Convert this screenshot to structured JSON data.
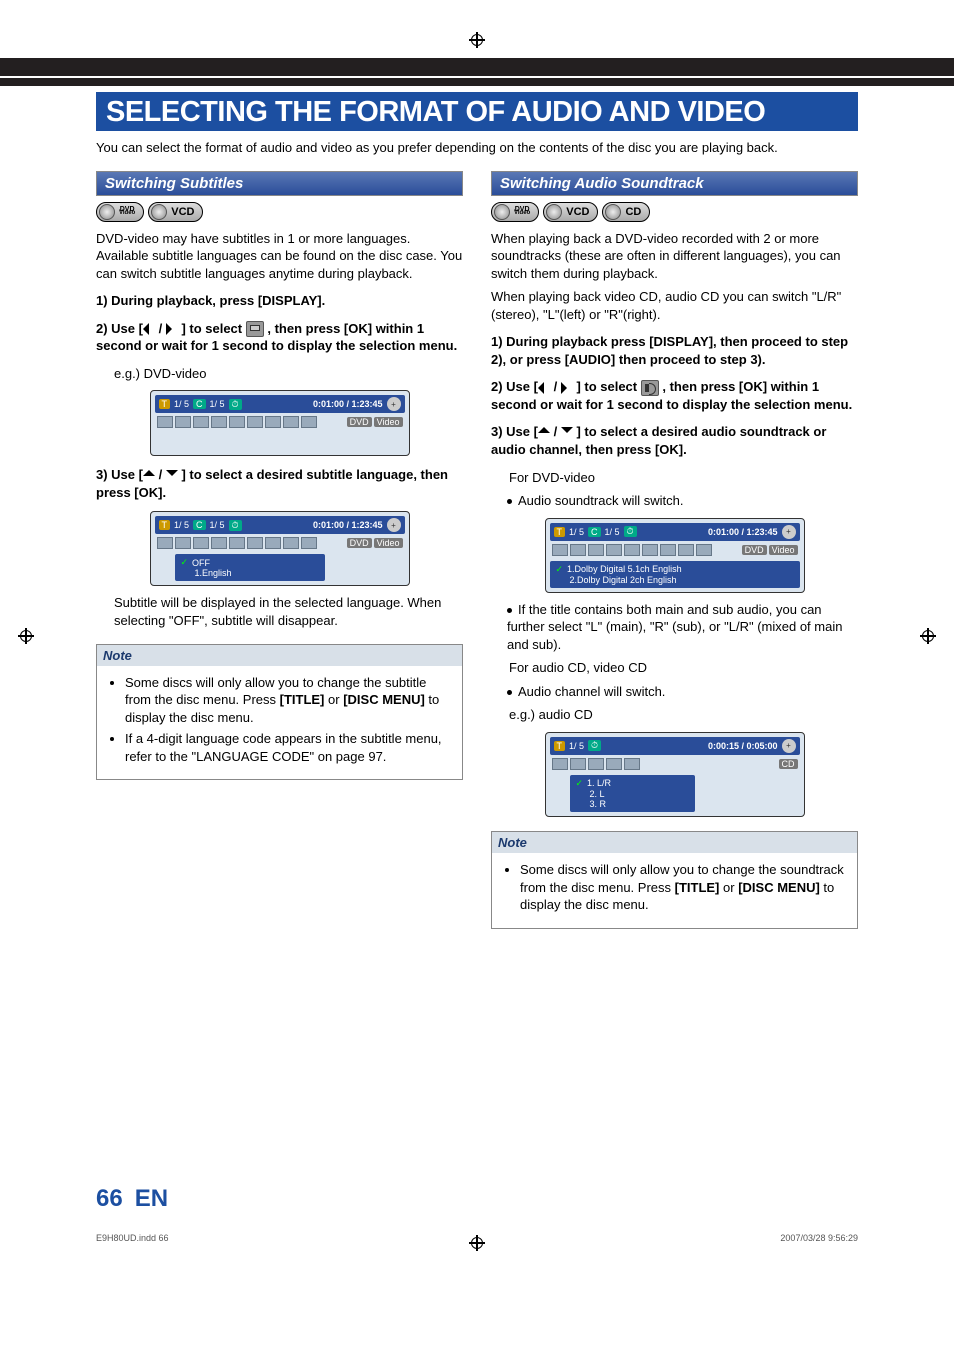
{
  "page_title": "SELECTING THE FORMAT OF AUDIO AND VIDEO",
  "intro": "You can select the format of audio and video as you prefer depending on the contents of the disc you are playing back.",
  "left": {
    "section_title": "Switching Subtitles",
    "discs": [
      "DVD Video",
      "VCD"
    ],
    "body1": "DVD-video may have subtitles in 1 or more languages. Available subtitle languages can be found on the disc case. You can switch subtitle languages anytime during playback.",
    "step1": "During playback, press [DISPLAY].",
    "step2_pre": "Use [",
    "step2_mid": "] to select ",
    "step2_post": " , then press [OK] within 1 second or wait for 1 second to display the selection menu.",
    "eg": "e.g.) DVD-video",
    "osd1": {
      "tc": [
        "1/  5",
        "1/  5"
      ],
      "time": "0:01:00 / 1:23:45",
      "badge1": "DVD",
      "badge2": "Video"
    },
    "step3_pre": "Use [",
    "step3_post": "] to select a desired subtitle language, then press [OK].",
    "osd2": {
      "tc": [
        "1/  5",
        "1/  5"
      ],
      "time": "0:01:00 / 1:23:45",
      "badge1": "DVD",
      "badge2": "Video",
      "menu": [
        "OFF",
        "1.English"
      ]
    },
    "after": "Subtitle will be displayed in the selected language. When selecting \"OFF\", subtitle will disappear.",
    "note_title": "Note",
    "note_items": [
      "Some discs will only allow you to change the subtitle from the disc menu. Press [TITLE] or [DISC MENU] to display the disc menu.",
      "If a 4-digit language code appears in the subtitle menu, refer to the \"LANGUAGE CODE\" on page 97."
    ]
  },
  "right": {
    "section_title": "Switching Audio Soundtrack",
    "discs": [
      "DVD Video",
      "VCD",
      "CD"
    ],
    "body1": "When playing back a DVD-video recorded with 2 or more soundtracks (these are often in different languages), you can switch them during playback.",
    "body2": "When playing back video CD, audio CD you can switch \"L/R\"(stereo), \"L\"(left) or \"R\"(right).",
    "step1": "During playback press [DISPLAY], then proceed to step 2), or press [AUDIO] then proceed to step 3).",
    "step2_pre": "Use [",
    "step2_mid": "] to select ",
    "step2_post": " , then press [OK] within 1 second or wait for 1 second to display the selection menu.",
    "step3_pre": "Use [",
    "step3_post": "] to select a desired audio soundtrack or audio channel, then press [OK].",
    "for_dvd": "For DVD-video",
    "bullet1": "Audio soundtrack will switch.",
    "osd1": {
      "tc": [
        "1/  5",
        "1/  5"
      ],
      "time": "0:01:00 / 1:23:45",
      "badge1": "DVD",
      "badge2": "Video",
      "menu": [
        "1.Dolby Digital  5.1ch English",
        "2.Dolby Digital    2ch English"
      ]
    },
    "bullet2": "If the title contains both main and sub audio, you can further select \"L\" (main), \"R\" (sub), or \"L/R\" (mixed of main and sub).",
    "for_cd": "For audio CD, video CD",
    "bullet3": "Audio channel will switch.",
    "eg": "e.g.) audio CD",
    "osd2": {
      "tc": [
        "1/  5"
      ],
      "time": "0:00:15 / 0:05:00",
      "badge1": "CD",
      "menu": [
        "1. L/R",
        "2. L",
        "3. R"
      ]
    },
    "note_title": "Note",
    "note_items": [
      "Some discs will only allow you to change the soundtrack from the disc menu. Press [TITLE] or [DISC MENU] to display the disc menu."
    ]
  },
  "page_number": "66",
  "page_lang": "EN",
  "footer_left": "E9H80UD.indd   66",
  "footer_right": "2007/03/28   9:56:29"
}
